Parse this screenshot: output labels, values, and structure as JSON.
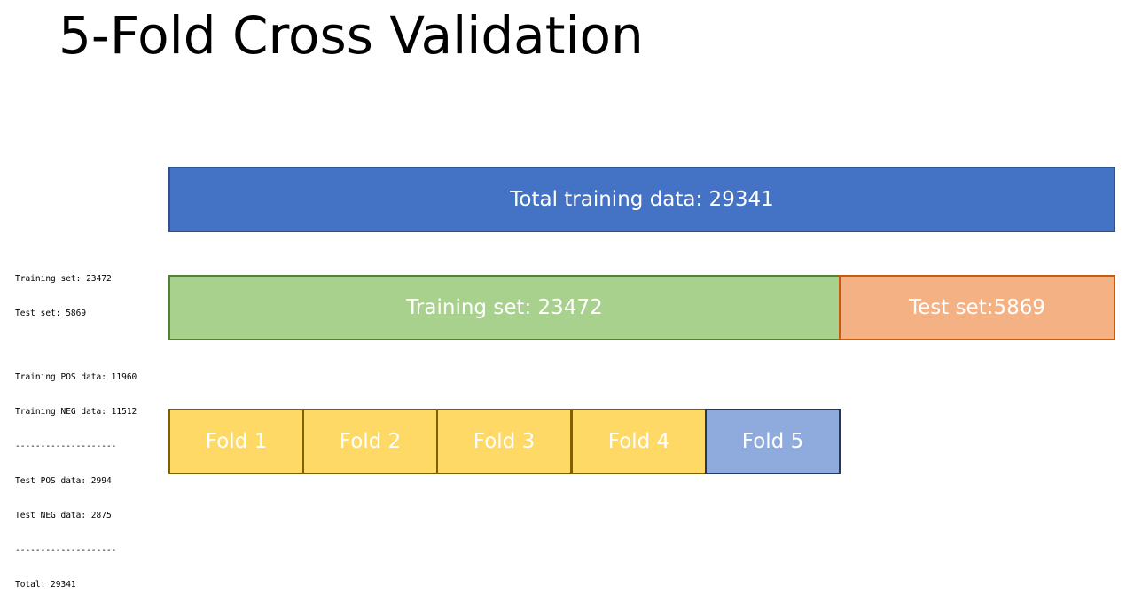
{
  "title": "5-Fold Cross Validation",
  "diagram": {
    "total_label": "Total training data: 29341",
    "training_label": "Training set: 23472",
    "test_label": "Test set:5869",
    "folds": [
      "Fold 1",
      "Fold 2",
      "Fold 3",
      "Fold 4",
      "Fold 5"
    ]
  },
  "console": {
    "lines_a": [
      "Training set: 23472",
      "Test set: 5869"
    ],
    "lines_b": [
      "Training POS data: 11960",
      "Training NEG data: 11512",
      "--------------------",
      "Test POS data: 2994",
      "Test NEG data: 2875",
      "--------------------",
      "Total: 29341"
    ]
  },
  "colors": {
    "total": "#4472C4",
    "training": "#A9D18E",
    "test": "#F4B183",
    "fold": "#FFD966",
    "fold_highlight": "#8FAADC"
  }
}
